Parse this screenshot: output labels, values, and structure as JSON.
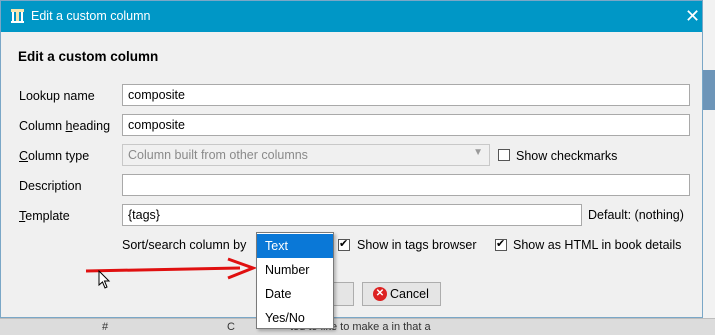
{
  "window": {
    "title": "Edit a custom column",
    "close_glyph": "✕"
  },
  "heading": "Edit a custom column",
  "form": {
    "lookup_name": {
      "label": "Lookup name",
      "value": "composite"
    },
    "column_heading": {
      "label_pre": "Column ",
      "label_u": "h",
      "label_post": "eading",
      "value": "composite"
    },
    "column_type": {
      "label_u": "C",
      "label_post": "olumn type",
      "value": "Column built from other columns",
      "show_checkmarks": "Show checkmarks"
    },
    "description": {
      "label": "Description",
      "value": ""
    },
    "template": {
      "label_u": "T",
      "label_post": "emplate",
      "value": "{tags}",
      "default_text": "Default: (nothing)"
    },
    "sort": {
      "label": "Sort/search column by",
      "options": [
        "Text",
        "Number",
        "Date",
        "Yes/No"
      ],
      "selected": "Text"
    },
    "show_in_tags_browser": "Show in tags browser",
    "show_as_html": "Show as HTML in book details"
  },
  "buttons": {
    "cancel": "Cancel"
  },
  "background": {
    "bottom_cell_1": "#",
    "bottom_cell_2": "C",
    "bottom_cell_3": "ted to like to make a in that a"
  },
  "colors": {
    "titlebar": "#0097c6",
    "selection": "#0a78d7",
    "arrow": "#e01010"
  }
}
